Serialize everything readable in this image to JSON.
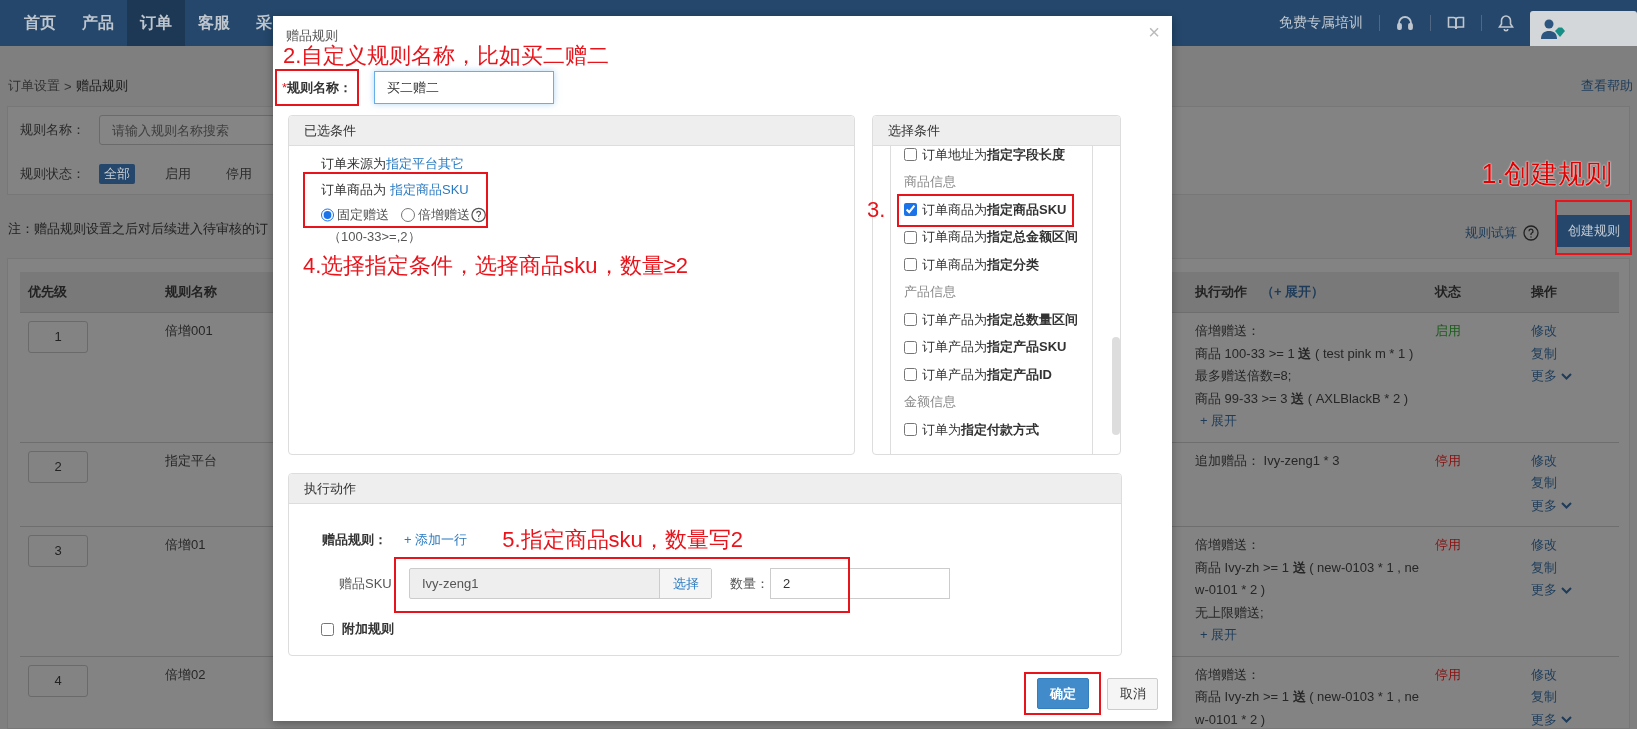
{
  "nav": {
    "items": [
      {
        "label": "首页",
        "selected": false
      },
      {
        "label": "产品",
        "selected": false
      },
      {
        "label": "订单",
        "selected": true
      },
      {
        "label": "客服",
        "selected": false
      },
      {
        "label": "采",
        "selected": false
      }
    ],
    "training_link": "免费专属培训"
  },
  "breadcrumb": {
    "parent": "订单设置",
    "separator": ">",
    "current": "赠品规则"
  },
  "help_link": "查看帮助",
  "filters": {
    "name_label": "规则名称：",
    "name_placeholder": "请输入规则名称搜索",
    "status_label": "规则状态：",
    "status_options": [
      {
        "label": "全部",
        "selected": true
      },
      {
        "label": "启用",
        "selected": false
      },
      {
        "label": "停用",
        "selected": false
      }
    ]
  },
  "note": "注：赠品规则设置之后对后续进入待审核的订",
  "rule_trial_link": "规则试算",
  "create_button": "创建规则",
  "table": {
    "columns": [
      "优先级",
      "规则名称",
      "执行动作",
      "状态",
      "操作"
    ],
    "expand_all": "（+ 展开）",
    "rows": [
      {
        "priority": "1",
        "name": "倍增001",
        "action_lines": [
          "倍增赠送：",
          "商品 100-33 >= 1 **送** ( test pink m * 1 )",
          "最多赠送倍数=8;",
          "商品 99-33 >= 3 **送** ( AXLBlackB * 2 )"
        ],
        "expand": "+ 展开",
        "status": "启用",
        "enabled": true,
        "operations": [
          "修改",
          "复制",
          "更多"
        ]
      },
      {
        "priority": "2",
        "name": "指定平台",
        "action_lines": [
          "追加赠品： Ivy-zeng1 * 3"
        ],
        "status": "停用",
        "enabled": false,
        "operations": [
          "修改",
          "复制",
          "更多"
        ]
      },
      {
        "priority": "3",
        "name": "倍增01",
        "action_lines": [
          "倍增赠送：",
          "商品 Ivy-zh >= 1 **送** ( new-0103 * 1 , new-0101 * 2 )",
          "无上限赠送;"
        ],
        "expand": "+ 展开",
        "status": "停用",
        "enabled": false,
        "operations": [
          "修改",
          "复制",
          "更多"
        ]
      },
      {
        "priority": "4",
        "name": "倍增02",
        "action_lines": [
          "倍增赠送：",
          "商品 Ivy-zh >= 1 **送** ( new-0103 * 1 , new-0101 * 2 )"
        ],
        "status": "停用",
        "enabled": false,
        "operations": [
          "修改",
          "复制",
          "更多"
        ]
      }
    ]
  },
  "modal": {
    "title": "赠品规则",
    "close": "×",
    "name_field": {
      "required_mark": "*",
      "label": "规则名称：",
      "value": "买二赠二"
    },
    "selected_conditions": {
      "title": "已选条件",
      "conditions": [
        {
          "text": "订单来源为",
          "link": "指定平台其它",
          "boxed": false
        },
        {
          "text": "订单商品为",
          "link": "指定商品SKU",
          "boxed": true,
          "modes": [
            {
              "label": "固定赠送",
              "selected": true
            },
            {
              "label": "倍增赠送",
              "selected": false
            }
          ],
          "hint": "（100-33>=,2）"
        }
      ]
    },
    "condition_options": {
      "title": "选择条件",
      "items": [
        {
          "kind": "option",
          "text": "订单地址为**指定字段长度**",
          "checked": false,
          "boxed": false
        },
        {
          "kind": "group",
          "text": "商品信息"
        },
        {
          "kind": "option",
          "text": "订单商品为**指定商品SKU**",
          "checked": true,
          "boxed": true
        },
        {
          "kind": "option",
          "text": "订单商品为**指定总金额区间**",
          "checked": false,
          "boxed": false
        },
        {
          "kind": "option",
          "text": "订单商品为**指定分类**",
          "checked": false,
          "boxed": false
        },
        {
          "kind": "group",
          "text": "产品信息"
        },
        {
          "kind": "option",
          "text": "订单产品为**指定总数量区间**",
          "checked": false,
          "boxed": false
        },
        {
          "kind": "option",
          "text": "订单产品为**指定产品SKU**",
          "checked": false,
          "boxed": false
        },
        {
          "kind": "option",
          "text": "订单产品为**指定产品ID**",
          "checked": false,
          "boxed": false
        },
        {
          "kind": "group",
          "text": "金额信息"
        },
        {
          "kind": "option",
          "text": "订单为**指定付款方式**",
          "checked": false,
          "boxed": false
        }
      ]
    },
    "actions": {
      "title": "执行动作",
      "rule_label": "赠品规则：",
      "add_row": "+ 添加一行",
      "sku_label": "赠品SKU",
      "sku_value": "Ivy-zeng1",
      "choose_button": "选择",
      "quantity_label": "数量：",
      "quantity_value": "2",
      "extra_rule": {
        "label": "附加规则",
        "checked": false
      }
    },
    "buttons": [
      {
        "label": "确定",
        "kind": "primary"
      },
      {
        "label": "取消",
        "kind": "default"
      }
    ]
  },
  "annotations": [
    "1.创建规则",
    "2.自定义规则名称，比如买二赠二",
    "3.",
    "4.选择指定条件，选择商品sku，数量≥2",
    "5.指定商品sku，数量写2"
  ]
}
